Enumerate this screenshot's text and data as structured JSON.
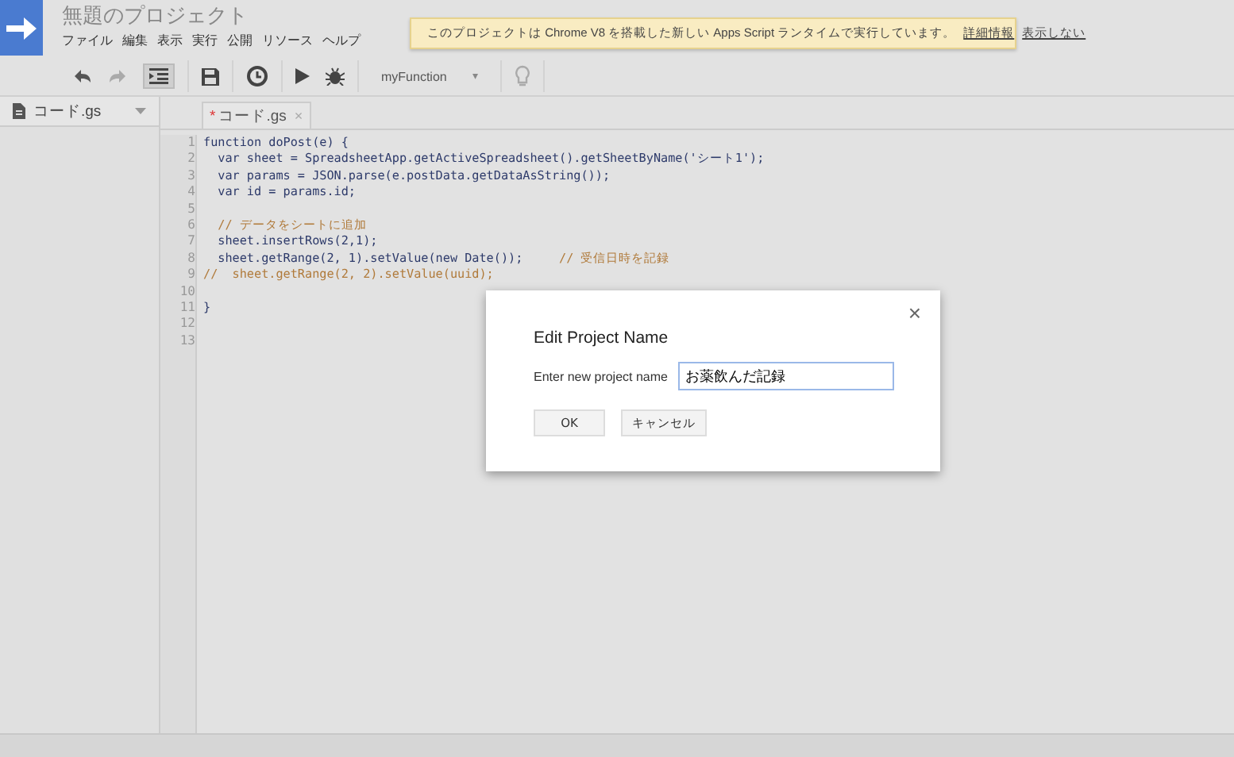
{
  "header": {
    "title": "無題のプロジェクト",
    "menu": [
      "ファイル",
      "編集",
      "表示",
      "実行",
      "公開",
      "リソース",
      "ヘルプ"
    ]
  },
  "notice": {
    "text": "このプロジェクトは Chrome V8 を搭載した新しい Apps Script ランタイムで実行しています。",
    "links": [
      "詳細情報",
      "表示しない"
    ]
  },
  "toolbar": {
    "function_select": "myFunction",
    "caret": "▾"
  },
  "sidebar": {
    "files": [
      {
        "name": "コード.gs",
        "selected": true
      }
    ]
  },
  "editor": {
    "tabs": [
      {
        "name": "コード.gs",
        "modified_mark": "*",
        "close": "×",
        "selected": true
      }
    ],
    "lines": [
      {
        "number": "1",
        "code": "function doPost(e) {"
      },
      {
        "number": "2",
        "code": "  var sheet = SpreadsheetApp.getActiveSpreadsheet().getSheetByName('シート1');"
      },
      {
        "number": "3",
        "code": "  var params = JSON.parse(e.postData.getDataAsString());"
      },
      {
        "number": "4",
        "code": "  var id = params.id;"
      },
      {
        "number": "5"
      },
      {
        "number": "6",
        "comment": "  // データをシートに追加"
      },
      {
        "number": "7",
        "code": "  sheet.insertRows(2,1);"
      },
      {
        "number": "8",
        "code": "  sheet.getRange(2, 1).setValue(new Date());     ",
        "comment": "// 受信日時を記録"
      },
      {
        "number": "9",
        "comment": "//  sheet.getRange(2, 2).setValue(uuid);"
      },
      {
        "number": "10"
      },
      {
        "number": "11",
        "code": "}"
      },
      {
        "number": "12"
      },
      {
        "number": "13"
      }
    ]
  },
  "dialog": {
    "title": "Edit Project Name",
    "close": "×",
    "label": "Enter new project name",
    "value": "お薬飲んだ記録",
    "buttons": [
      "OK",
      "キャンセル"
    ]
  }
}
